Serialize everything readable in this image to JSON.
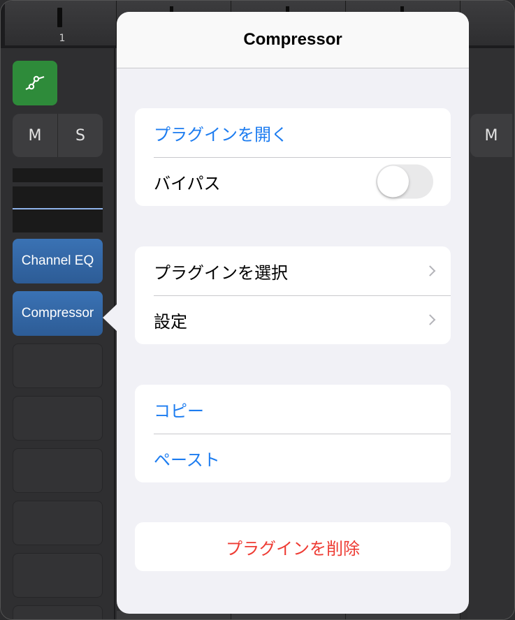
{
  "mixer": {
    "channel_number": "1",
    "mute_label": "M",
    "solo_label": "S",
    "right_mute_label": "M",
    "plugins": [
      "Channel EQ",
      "Compressor"
    ]
  },
  "popover": {
    "title": "Compressor",
    "groups": [
      {
        "open_plugin": "プラグインを開く",
        "bypass": "バイパス",
        "bypass_on": false
      },
      {
        "select_plugin": "プラグインを選択",
        "settings": "設定"
      },
      {
        "copy": "コピー",
        "paste": "ペースト"
      },
      {
        "delete_plugin": "プラグインを削除"
      }
    ]
  },
  "colors": {
    "accent_blue": "#1c7cf0",
    "destructive_red": "#ee3b33",
    "automation_green": "#2e8b3a",
    "plugin_blue": "#3a72b4"
  },
  "icons": {
    "automation": "automation-curve-icon",
    "chevron": "chevron-right-icon"
  }
}
